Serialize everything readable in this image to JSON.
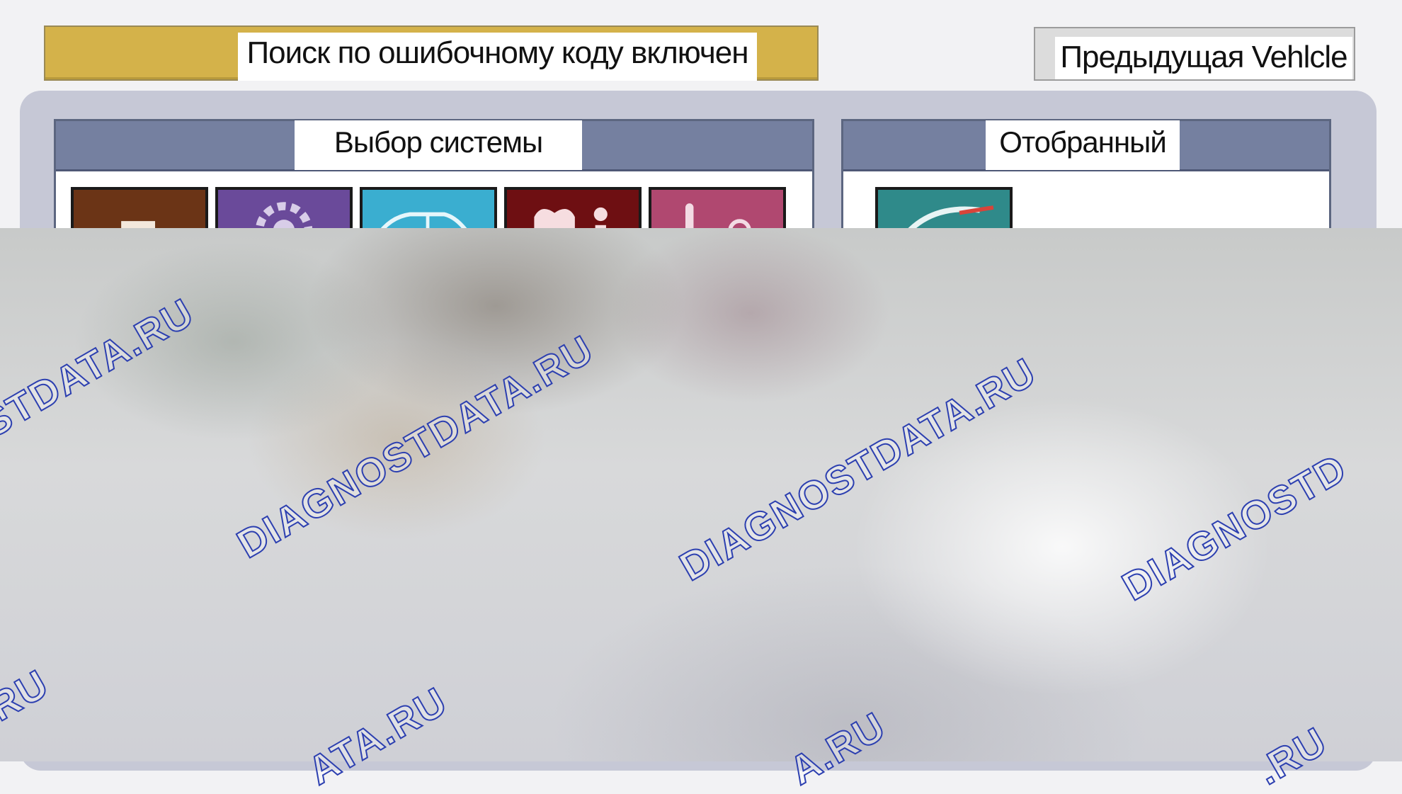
{
  "toolbar": {
    "search_label": "Поиск по ошибочному коду включен",
    "prev_label": "Предыдущая Vehlcle"
  },
  "groups": {
    "system_title": "Выбор системы",
    "selected_title": "Отобранный"
  },
  "watermark": {
    "text_full": "DIAGNOSTDATA.RU",
    "text_a": "STDATA.RU",
    "text_b": "DIAGNOSTD",
    "text_c": "RU",
    "text_d": "ATA.RU",
    "text_e": "A.RU",
    "text_f": ".RU"
  },
  "icons": {
    "system_tiles": [
      "engine-icon",
      "gear-icon",
      "car-body-icon",
      "airbag-info-icon",
      "climate-icon"
    ],
    "selected_tiles": [
      "selected-system-icon"
    ]
  },
  "colors": {
    "search_button": "#d4b24a",
    "group_header": "#7580a0",
    "watermark_stroke": "#2c3fb0"
  }
}
